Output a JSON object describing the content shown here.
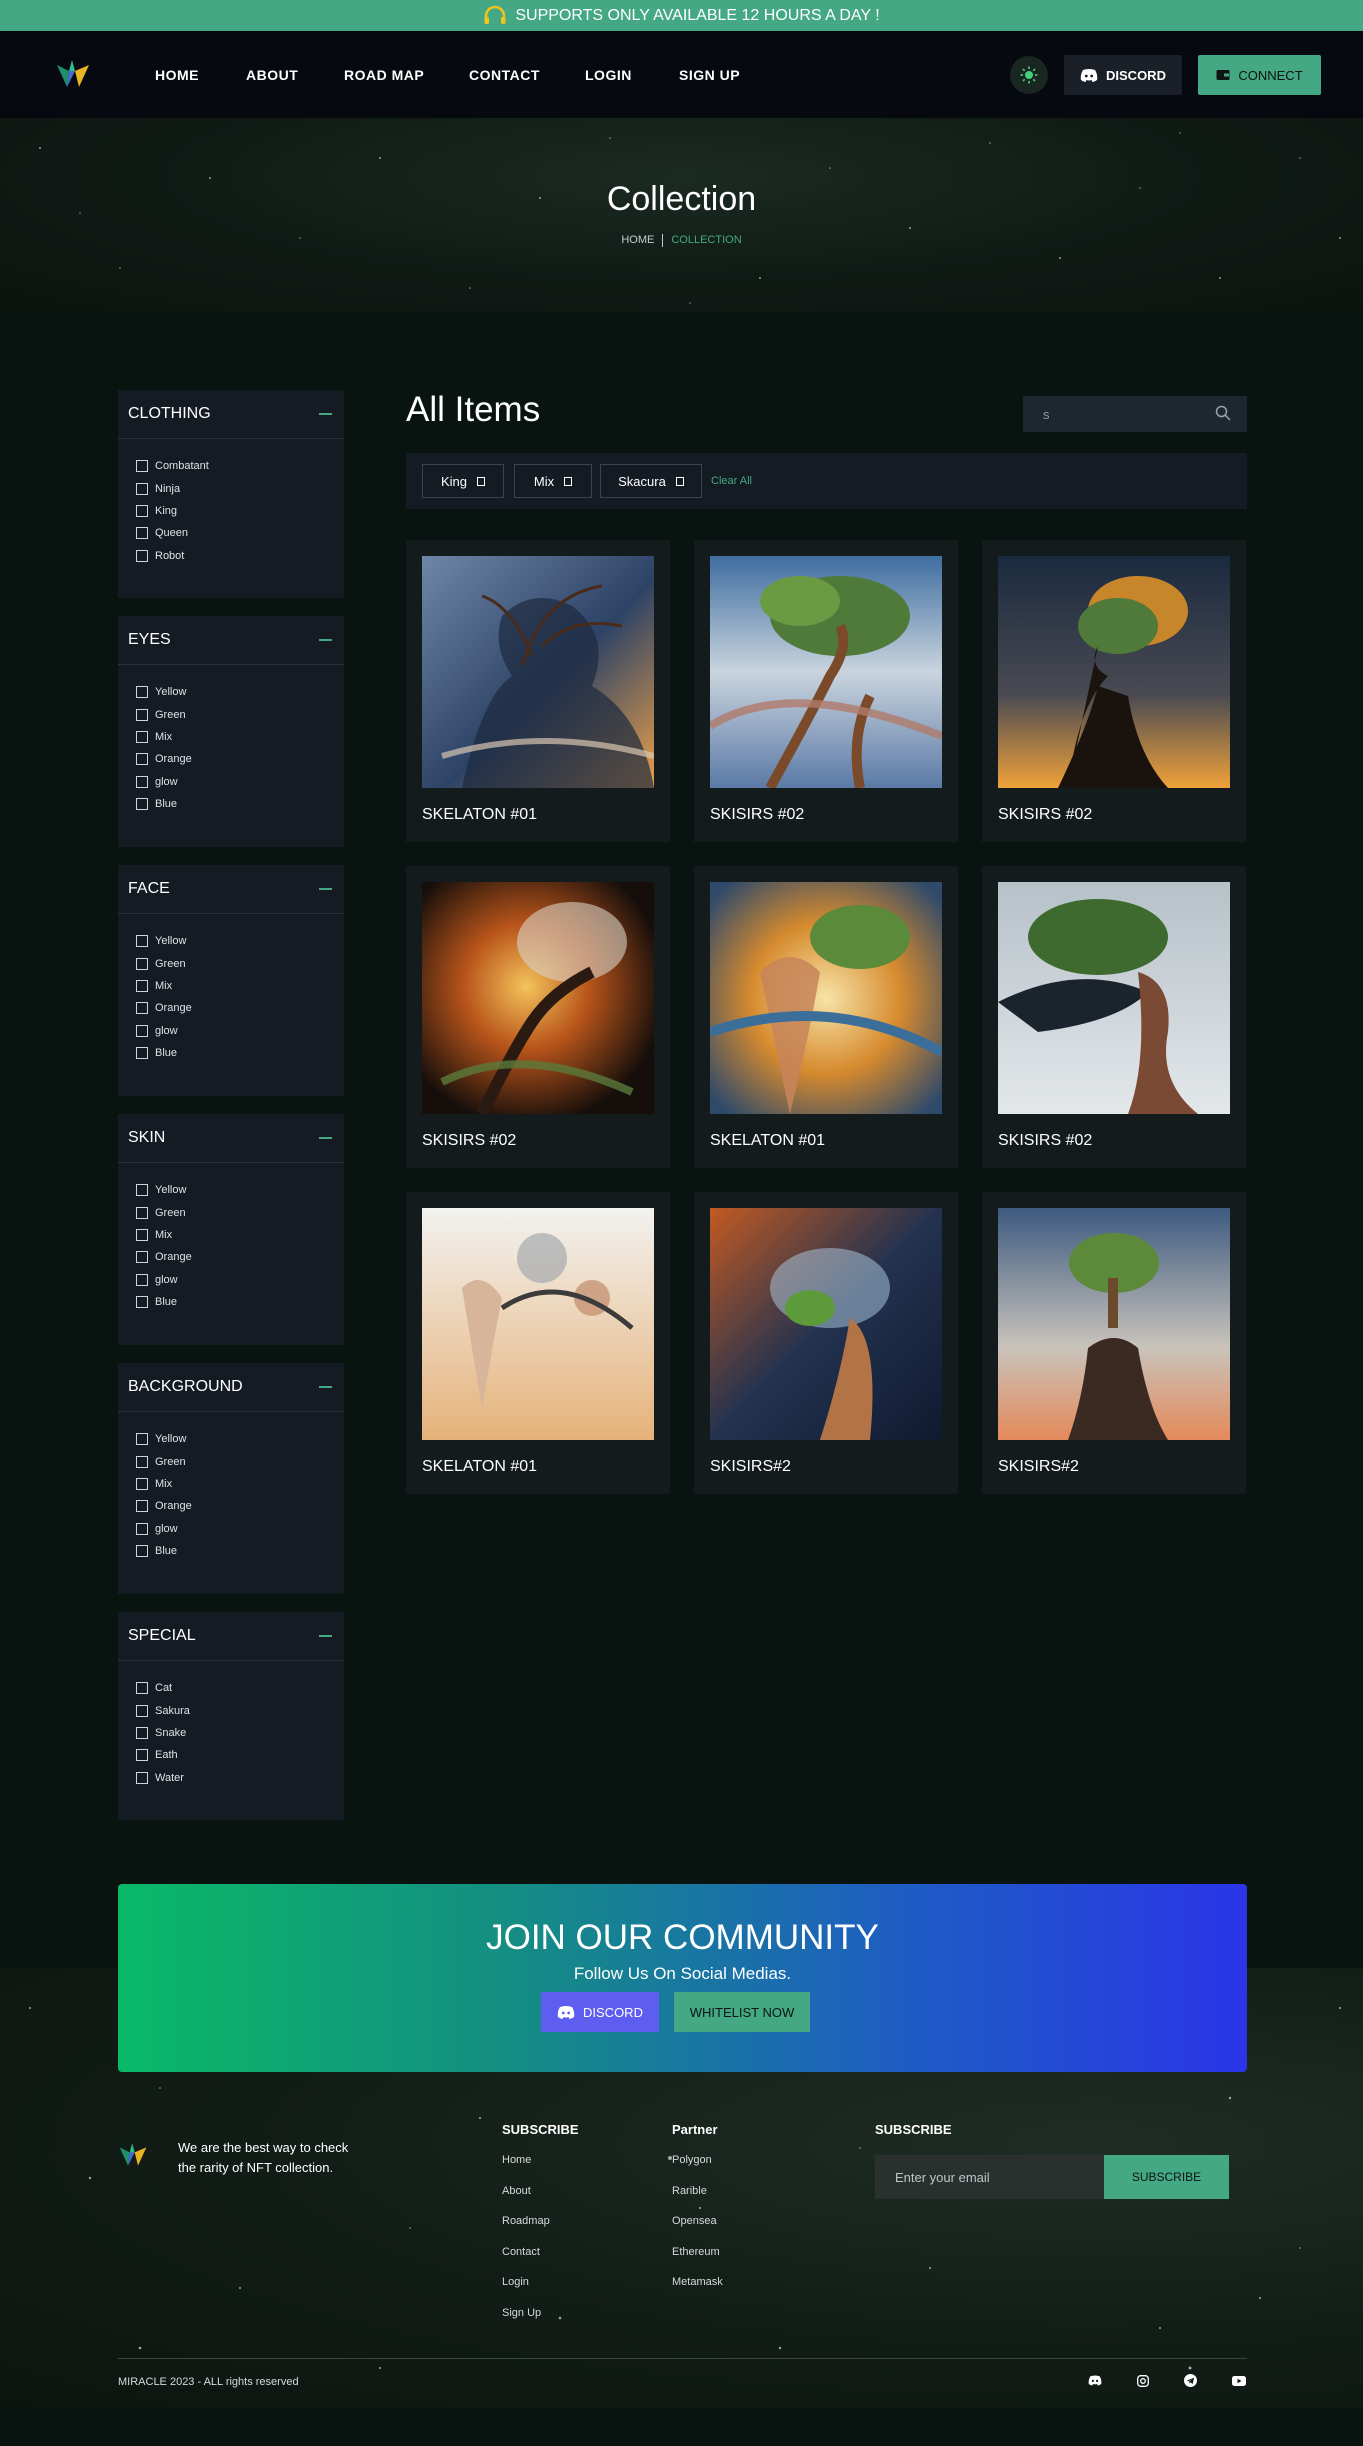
{
  "announcement": "SUPPORTS ONLY AVAILABLE 12 HOURS A DAY !",
  "nav": [
    "HOME",
    "ABOUT",
    "ROAD MAP",
    "CONTACT",
    "LOGIN",
    "SIGN UP"
  ],
  "header": {
    "discord_label": "DISCORD",
    "connect_label": "CONNECT"
  },
  "hero": {
    "title": "Collection",
    "crumb_home": "HOME",
    "crumb_current": "COLLECTION"
  },
  "filters": [
    {
      "title": "CLOTHING",
      "options": [
        "Combatant",
        "Ninja",
        "King",
        "Queen",
        "Robot"
      ]
    },
    {
      "title": "EYES",
      "options": [
        "Yellow",
        "Green",
        "Mix",
        "Orange",
        "glow",
        "Blue"
      ]
    },
    {
      "title": "FACE",
      "options": [
        "Yellow",
        "Green",
        "Mix",
        "Orange",
        "glow",
        "Blue"
      ]
    },
    {
      "title": "SKIN",
      "options": [
        "Yellow",
        "Green",
        "Mix",
        "Orange",
        "glow",
        "Blue"
      ]
    },
    {
      "title": "BACKGROUND",
      "options": [
        "Yellow",
        "Green",
        "Mix",
        "Orange",
        "glow",
        "Blue"
      ]
    },
    {
      "title": "SPECIAL",
      "options": [
        "Cat",
        "Sakura",
        "Snake",
        "Eath",
        "Water"
      ]
    }
  ],
  "main": {
    "title": "All Items",
    "search_value": "s",
    "tags": [
      "King",
      "Mix",
      "Skacura"
    ],
    "clear_label": "Clear All",
    "items": [
      "SKELATON #01",
      "SKISIRS #02",
      "SKISIRS #02",
      "SKISIRS #02",
      "SKELATON #01",
      "SKISIRS #02",
      "SKELATON #01",
      "SKISIRS#2",
      "SKISIRS#2"
    ]
  },
  "community": {
    "title": "JOIN OUR COMMUNITY",
    "subtitle": "Follow Us On Social Medias.",
    "discord_label": "DISCORD",
    "whitelist_label": "WHITELIST NOW"
  },
  "footer": {
    "description": "We are the best way to check the rarity of NFT collection.",
    "col1": {
      "title": "SUBSCRIBE",
      "links": [
        "Home",
        "About",
        "Roadmap",
        "Contact",
        "Login",
        "Sign Up"
      ]
    },
    "col2": {
      "title": "Partner",
      "links": [
        "Polygon",
        "Rarible",
        "Opensea",
        "Ethereum",
        "Metamask"
      ]
    },
    "subscribe": {
      "title": "SUBSCRIBE",
      "placeholder": "Enter your email",
      "button": "SUBSCRIBE"
    },
    "copyright": "MIRACLE 2023 - ALL rights reserved",
    "socials": [
      "discord-icon",
      "instagram-icon",
      "telegram-icon",
      "youtube-icon"
    ]
  },
  "colors": {
    "accent": "#43a883",
    "bg": "#09130f",
    "panel": "#141b22"
  }
}
